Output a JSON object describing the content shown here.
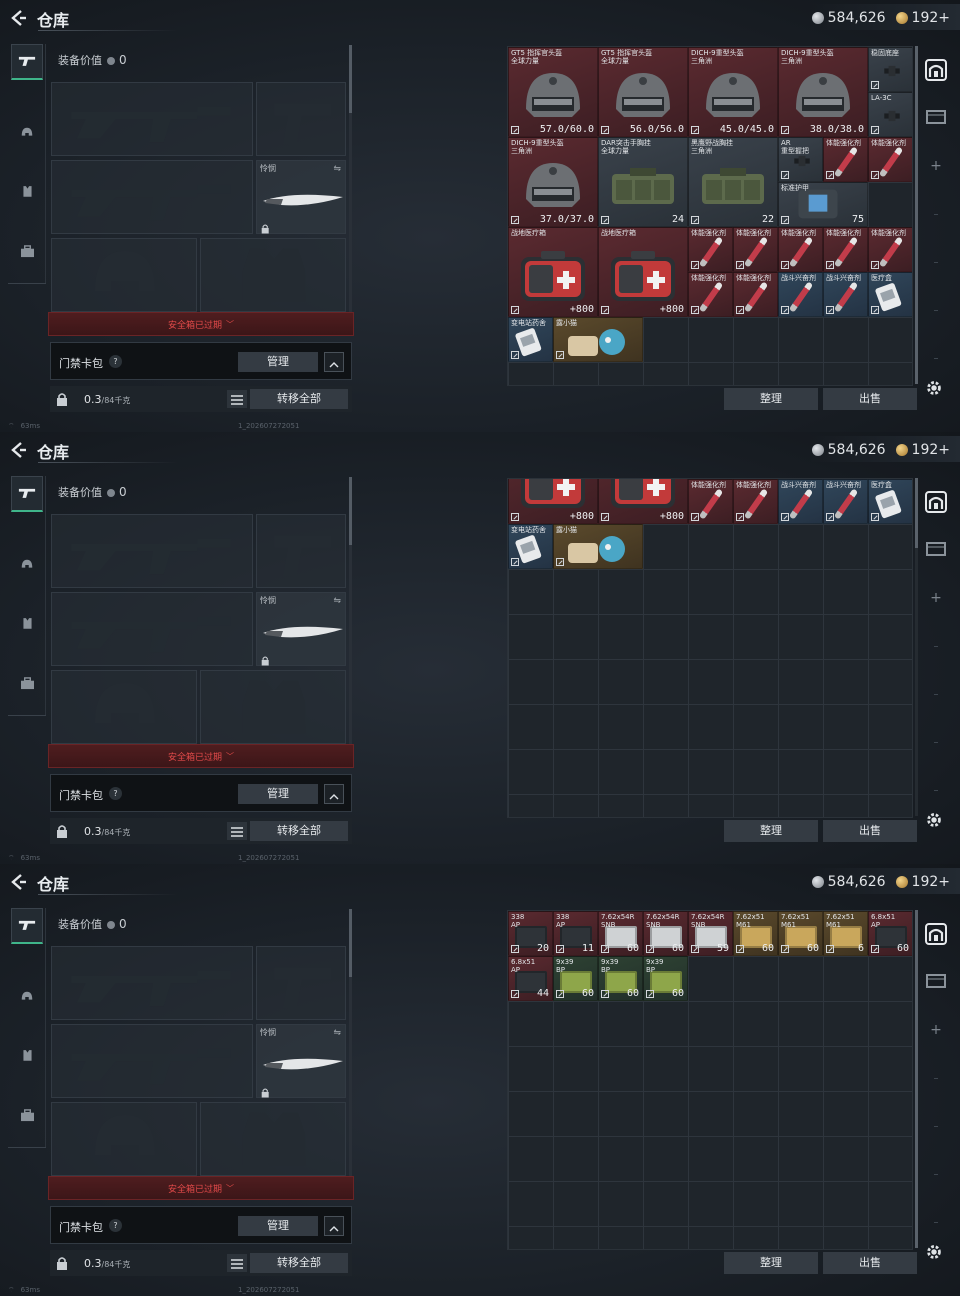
{
  "panels": [
    {
      "title": "仓库",
      "currency": {
        "silver": "584,626",
        "gold": "192+"
      },
      "equip_value_label": "装备价值",
      "equip_value": "0",
      "melee_label": "怜悯",
      "safe_box": "安全箱已过期",
      "card_label": "门禁卡包",
      "card_help": "?",
      "manage_label": "管理",
      "weight": "0.3",
      "weight_unit": "/84千克",
      "transfer_label": "转移全部",
      "sort_label": "整理",
      "sell_label": "出售",
      "status_ping": "63ms",
      "status_build": "1_202607272051",
      "items": [
        {
          "name": "GT5 指挥官头盔\n全球力量",
          "value": "57.0/60.0",
          "color": "red",
          "kind": "helmet"
        },
        {
          "name": "GT5 指挥官头盔\n全球力量",
          "value": "56.0/56.0",
          "color": "red",
          "kind": "helmet"
        },
        {
          "name": "DICH-9重型头盔\n三角洲",
          "value": "45.0/45.0",
          "color": "red",
          "kind": "helmet"
        },
        {
          "name": "DICH-9重型头盔\n三角洲",
          "value": "38.0/38.0",
          "color": "red",
          "kind": "helmet"
        },
        {
          "name": "稳固底座",
          "value": "",
          "color": "grey",
          "kind": "part"
        },
        {
          "name": "LA-3C",
          "value": "",
          "color": "grey",
          "kind": "part"
        },
        {
          "name": "DICH-9重型头盔\n三角洲",
          "value": "37.0/37.0",
          "color": "red",
          "kind": "helmet"
        },
        {
          "name": "DAR突击手胸挂\n全球力量",
          "value": "24",
          "color": "grey",
          "kind": "bag"
        },
        {
          "name": "黑鹰野战胸挂\n三角洲",
          "value": "22",
          "color": "grey",
          "kind": "bag"
        },
        {
          "name": "AR\n重型握把",
          "value": "",
          "color": "grey",
          "kind": "part"
        },
        {
          "name": "体能强化剂",
          "value": "",
          "color": "red",
          "kind": "syringe"
        },
        {
          "name": "体能强化剂",
          "value": "",
          "color": "red",
          "kind": "syringe"
        },
        {
          "name": "标准护甲",
          "value": "75",
          "color": "grey",
          "kind": "armor"
        },
        {
          "name": "战地医疗箱",
          "value": "+800",
          "color": "red",
          "kind": "medkit"
        },
        {
          "name": "战地医疗箱",
          "value": "+800",
          "color": "red",
          "kind": "medkit"
        },
        {
          "name": "体能强化剂",
          "value": "",
          "color": "red",
          "kind": "syringe"
        },
        {
          "name": "体能强化剂",
          "value": "",
          "color": "red",
          "kind": "syringe"
        },
        {
          "name": "体能强化剂",
          "value": "",
          "color": "red",
          "kind": "syringe"
        },
        {
          "name": "体能强化剂",
          "value": "",
          "color": "red",
          "kind": "syringe"
        },
        {
          "name": "体能强化剂",
          "value": "",
          "color": "red",
          "kind": "syringe"
        },
        {
          "name": "体能强化剂",
          "value": "",
          "color": "red",
          "kind": "syringe"
        },
        {
          "name": "体能强化剂",
          "value": "",
          "color": "red",
          "kind": "syringe"
        },
        {
          "name": "战斗兴奋剂",
          "value": "",
          "color": "blue",
          "kind": "syringe"
        },
        {
          "name": "战斗兴奋剂",
          "value": "",
          "color": "blue",
          "kind": "syringe"
        },
        {
          "name": "医疗盒",
          "value": "",
          "color": "blue",
          "kind": "small"
        },
        {
          "name": "变电站药舍",
          "value": "",
          "color": "blue",
          "kind": "small"
        },
        {
          "name": "露小猫",
          "value": "",
          "color": "gold",
          "kind": "toy"
        }
      ]
    },
    {
      "title": "仓库",
      "currency": {
        "silver": "584,626",
        "gold": "192+"
      },
      "equip_value_label": "装备价值",
      "equip_value": "0",
      "melee_label": "怜悯",
      "safe_box": "安全箱已过期",
      "card_label": "门禁卡包",
      "card_help": "?",
      "manage_label": "管理",
      "weight": "0.3",
      "weight_unit": "/84千克",
      "transfer_label": "转移全部",
      "sort_label": "整理",
      "sell_label": "出售",
      "status_ping": "63ms",
      "status_build": "1_202607272051",
      "items": [
        {
          "name": "",
          "value": "+800",
          "color": "red",
          "kind": "medkit"
        },
        {
          "name": "",
          "value": "+800",
          "color": "red",
          "kind": "medkit"
        },
        {
          "name": "体能强化剂",
          "value": "",
          "color": "red",
          "kind": "syringe"
        },
        {
          "name": "体能强化剂",
          "value": "",
          "color": "red",
          "kind": "syringe"
        },
        {
          "name": "战斗兴奋剂",
          "value": "",
          "color": "blue",
          "kind": "syringe"
        },
        {
          "name": "战斗兴奋剂",
          "value": "",
          "color": "blue",
          "kind": "syringe"
        },
        {
          "name": "医疗盒",
          "value": "",
          "color": "blue",
          "kind": "small"
        },
        {
          "name": "变电站药舍",
          "value": "",
          "color": "blue",
          "kind": "small"
        },
        {
          "name": "露小猫",
          "value": "",
          "color": "gold",
          "kind": "toy"
        }
      ]
    },
    {
      "title": "仓库",
      "currency": {
        "silver": "584,626",
        "gold": "192+"
      },
      "equip_value_label": "装备价值",
      "equip_value": "0",
      "melee_label": "怜悯",
      "safe_box": "安全箱已过期",
      "card_label": "门禁卡包",
      "card_help": "?",
      "manage_label": "管理",
      "weight": "0.3",
      "weight_unit": "/84千克",
      "transfer_label": "转移全部",
      "sort_label": "整理",
      "sell_label": "出售",
      "status_ping": "63ms",
      "status_build": "1_202607272051",
      "items": [
        {
          "name": "338\nAP",
          "value": "20",
          "color": "red",
          "kind": "ammo-dark"
        },
        {
          "name": "338\nAP",
          "value": "11",
          "color": "red",
          "kind": "ammo-dark"
        },
        {
          "name": "7.62x54R\nSNB",
          "value": "60",
          "color": "red",
          "kind": "ammo-light"
        },
        {
          "name": "7.62x54R\nSNB",
          "value": "60",
          "color": "red",
          "kind": "ammo-light"
        },
        {
          "name": "7.62x54R\nSNB",
          "value": "59",
          "color": "red",
          "kind": "ammo-light"
        },
        {
          "name": "7.62x51\nM61",
          "value": "60",
          "color": "gold",
          "kind": "ammo-gold"
        },
        {
          "name": "7.62x51\nM61",
          "value": "60",
          "color": "gold",
          "kind": "ammo-gold"
        },
        {
          "name": "7.62x51\nM61",
          "value": "6",
          "color": "gold",
          "kind": "ammo-gold"
        },
        {
          "name": "6.8x51\nAP",
          "value": "60",
          "color": "red",
          "kind": "ammo-dark"
        },
        {
          "name": "6.8x51\nAP",
          "value": "44",
          "color": "red",
          "kind": "ammo-dark"
        },
        {
          "name": "9x39\nBP",
          "value": "60",
          "color": "green",
          "kind": "ammo-green"
        },
        {
          "name": "9x39\nBP",
          "value": "60",
          "color": "green",
          "kind": "ammo-green"
        },
        {
          "name": "9x39\nBP",
          "value": "60",
          "color": "green",
          "kind": "ammo-green"
        }
      ]
    }
  ]
}
